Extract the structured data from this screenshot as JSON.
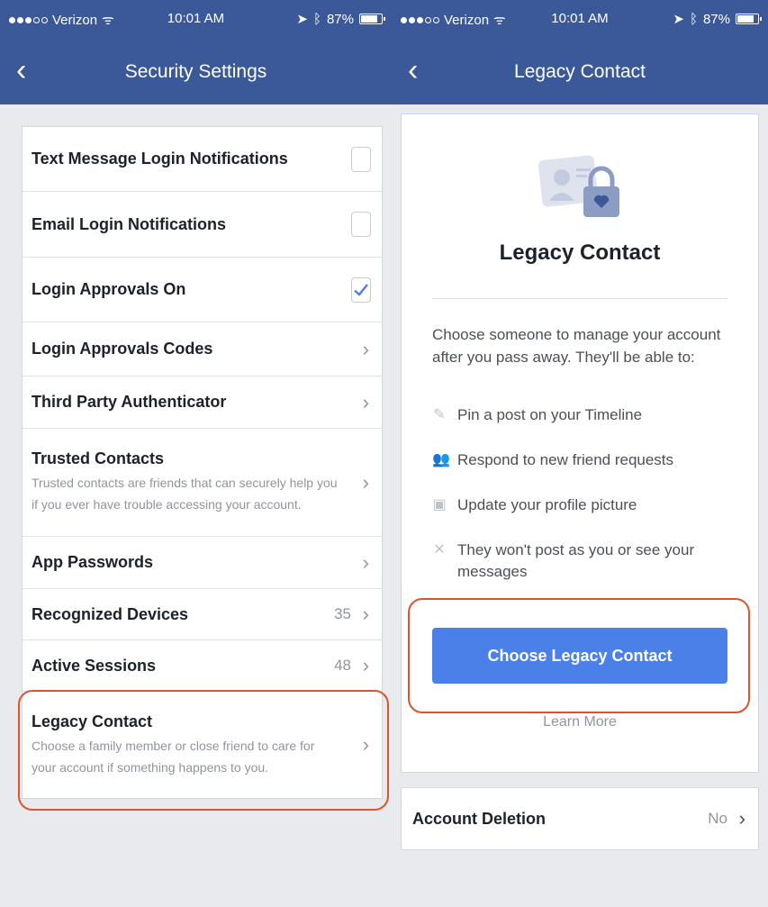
{
  "status_bar": {
    "carrier": "Verizon",
    "time": "10:01 AM",
    "battery": "87%",
    "battery_level": 0.87
  },
  "left_screen": {
    "nav_title": "Security Settings",
    "back_icon": "chevron-left-icon",
    "rows": [
      {
        "label": "Text Message Login Notifications",
        "control": "checkbox",
        "checked": false
      },
      {
        "label": "Email Login Notifications",
        "control": "checkbox",
        "checked": false
      },
      {
        "label": "Login Approvals On",
        "control": "checkbox",
        "checked": true
      },
      {
        "label": "Login Approvals Codes",
        "control": "chevron"
      },
      {
        "label": "Third Party Authenticator",
        "control": "chevron"
      },
      {
        "label": "Trusted Contacts",
        "description": "Trusted contacts are friends that can securely help you if you ever have trouble accessing your account.",
        "control": "chevron"
      },
      {
        "label": "App Passwords",
        "control": "chevron"
      },
      {
        "label": "Recognized Devices",
        "count": "35",
        "control": "chevron"
      },
      {
        "label": "Active Sessions",
        "count": "48",
        "control": "chevron"
      },
      {
        "label": "Legacy Contact",
        "description": "Choose a family member or close friend to care for your account if something happens to you.",
        "control": "chevron"
      }
    ]
  },
  "right_screen": {
    "nav_title": "Legacy Contact",
    "card_title": "Legacy Contact",
    "intro": "Choose someone to manage your account after you pass away. They'll be able to:",
    "features": [
      {
        "icon": "pencil-icon",
        "text": "Pin a post on your Timeline"
      },
      {
        "icon": "friends-icon",
        "text": "Respond to new friend requests"
      },
      {
        "icon": "camera-icon",
        "text": "Update your profile picture"
      },
      {
        "icon": "x-icon",
        "text": "They won't post as you or see your messages"
      }
    ],
    "cta_label": "Choose Legacy Contact",
    "learn_more": "Learn More",
    "account_deletion": {
      "label": "Account Deletion",
      "value": "No"
    }
  },
  "colors": {
    "header": "#3b5998",
    "cta": "#4a80e8",
    "highlight": "#d8562f",
    "check": "#4a80e8"
  }
}
